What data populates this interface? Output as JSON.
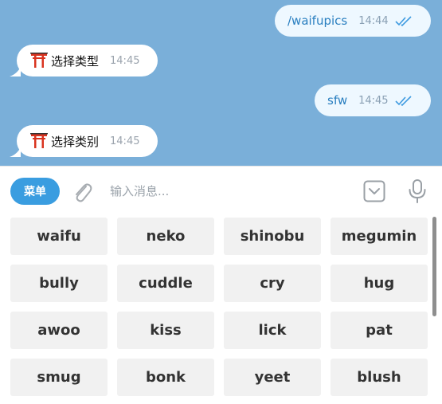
{
  "messages": [
    {
      "side": "out",
      "text": "/waifupics",
      "time": "14:44",
      "read": true
    },
    {
      "side": "in",
      "icon": "torii-gate-icon",
      "text": "选择类型",
      "time": "14:45"
    },
    {
      "side": "out",
      "text": "sfw",
      "time": "14:45",
      "read": true
    },
    {
      "side": "in",
      "icon": "torii-gate-icon",
      "text": "选择类别",
      "time": "14:45"
    }
  ],
  "composer": {
    "menu_label": "菜单",
    "input_placeholder": "输入消息..."
  },
  "keyboard": {
    "rows": [
      [
        "waifu",
        "neko",
        "shinobu",
        "megumin"
      ],
      [
        "bully",
        "cuddle",
        "cry",
        "hug"
      ],
      [
        "awoo",
        "kiss",
        "lick",
        "pat"
      ],
      [
        "smug",
        "bonk",
        "yeet",
        "blush"
      ]
    ]
  },
  "colors": {
    "chat_background": "#7aafd9",
    "outgoing_bubble": "#eef8ff",
    "incoming_bubble": "#ffffff",
    "accent": "#3a9de0",
    "key_background": "#f1f1f1"
  }
}
